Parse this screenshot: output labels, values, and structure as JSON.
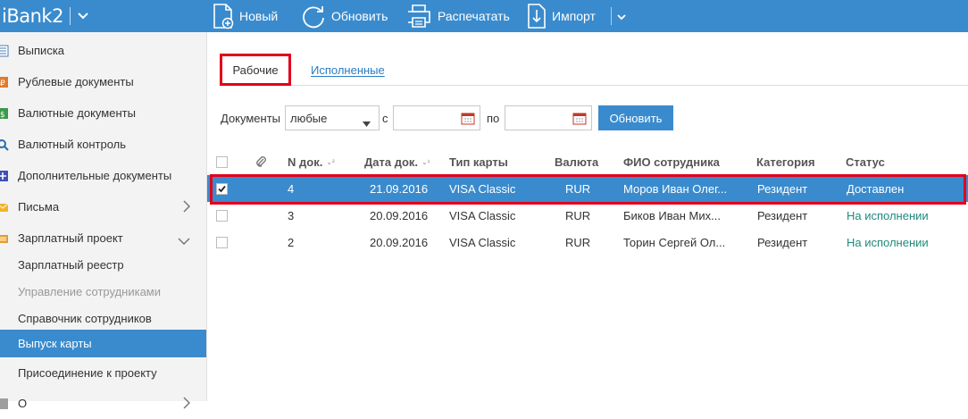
{
  "app": {
    "brand": "iBank2",
    "toolbar": {
      "new_label": "Новый",
      "refresh_label": "Обновить",
      "print_label": "Распечатать",
      "import_label": "Импорт"
    }
  },
  "sidebar": {
    "items": [
      {
        "label": "Выписка",
        "icon": "statement-icon"
      },
      {
        "label": "Рублевые документы",
        "icon": "ruble-doc-icon"
      },
      {
        "label": "Валютные документы",
        "icon": "currency-doc-icon"
      },
      {
        "label": "Валютный контроль",
        "icon": "search-icon"
      },
      {
        "label": "Дополнительные документы",
        "icon": "add-doc-icon"
      },
      {
        "label": "Письма",
        "icon": "letter-icon",
        "chevron": "chevron-right-icon"
      },
      {
        "label": "Зарплатный проект",
        "icon": "salary-icon",
        "chevron": "chevron-down-icon"
      },
      {
        "label": "Зарплатный реестр"
      },
      {
        "label": "Управление сотрудниками",
        "state": "disabled"
      },
      {
        "label": "Справочник сотрудников"
      },
      {
        "label": "Выпуск карты",
        "state": "active"
      },
      {
        "label": "Присоединение к проекту"
      },
      {
        "label": "О",
        "icon": "other-icon",
        "chevron": "chevron-right-icon"
      }
    ]
  },
  "tabs": {
    "working": "Рабочие",
    "executed": "Исполненные"
  },
  "filter": {
    "docs_label": "Документы",
    "docs_value": "любые",
    "from_label": "с",
    "to_label": "по",
    "from_value": "",
    "to_value": "",
    "refresh_button": "Обновить"
  },
  "table": {
    "headers": {
      "num": "N док.",
      "date": "Дата док.",
      "card_type": "Тип карты",
      "currency": "Валюта",
      "employee": "ФИО сотрудника",
      "category": "Категория",
      "status": "Статус"
    },
    "sort_num": "⌄²",
    "sort_date": "⌄¹",
    "rows": [
      {
        "num": "4",
        "date": "21.09.2016",
        "card_type": "VISA Classic",
        "currency": "RUR",
        "employee": "Моров Иван Олег...",
        "category": "Резидент",
        "status": "Доставлен",
        "checked": true
      },
      {
        "num": "3",
        "date": "20.09.2016",
        "card_type": "VISA Classic",
        "currency": "RUR",
        "employee": "Биков Иван Мих...",
        "category": "Резидент",
        "status": "На исполнении",
        "checked": false
      },
      {
        "num": "2",
        "date": "20.09.2016",
        "card_type": "VISA Classic",
        "currency": "RUR",
        "employee": "Торин Сергей Ол...",
        "category": "Резидент",
        "status": "На исполнении",
        "checked": false
      }
    ]
  },
  "colors": {
    "brand_blue": "#3a8bcd",
    "highlight_red": "#e2001a",
    "status_green": "#1f8a7e",
    "link_blue": "#2b7cc1"
  }
}
